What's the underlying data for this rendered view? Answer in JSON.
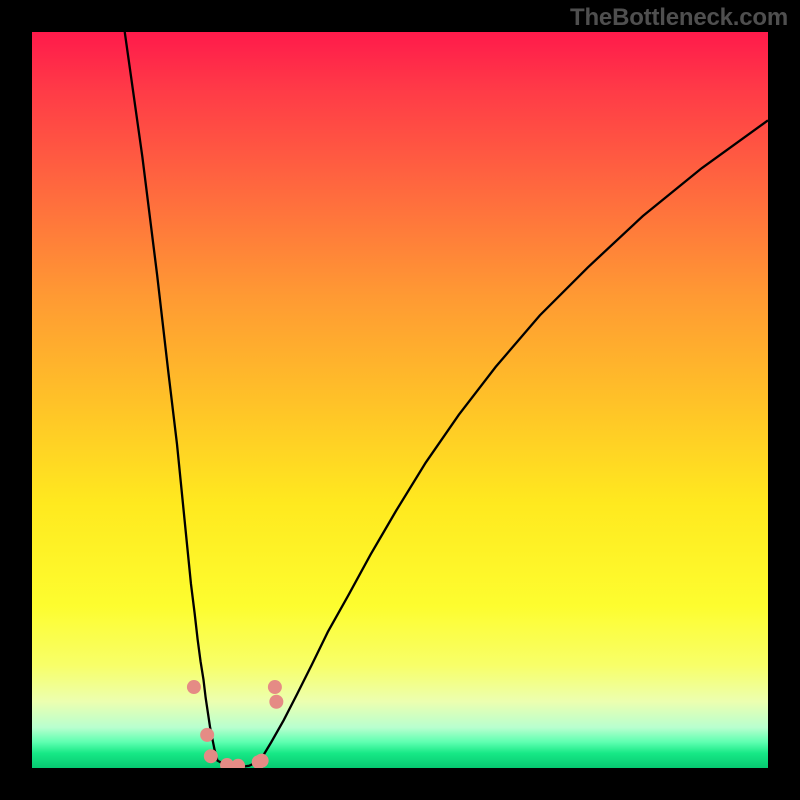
{
  "branding": {
    "text": "TheBottleneck.com"
  },
  "colors": {
    "frame": "#000000",
    "curve_stroke": "#000000",
    "marker_fill": "#e58b85",
    "gradient_stops": [
      "#ff1a4b",
      "#ff3b47",
      "#ff6b3e",
      "#ff9a33",
      "#ffc128",
      "#ffe91f",
      "#fdfd2f",
      "#f8ff68",
      "#ecffb0",
      "#b8ffcf",
      "#5dffb0",
      "#17e886",
      "#06c971"
    ]
  },
  "chart_data": {
    "type": "line",
    "title": "",
    "xlabel": "",
    "ylabel": "",
    "xlim": [
      0,
      100
    ],
    "ylim": [
      0,
      100
    ],
    "note": "Axes carry no tick labels in source; x/y in 0-100 plot-percent coords from top-left. Bottleneck V-curve: tight notch near x≈25, minimum y≈100 (bottom).",
    "series": [
      {
        "name": "left_branch",
        "x": [
          12.6,
          15.0,
          17.0,
          18.5,
          19.7,
          20.5,
          21.1,
          21.6,
          22.1,
          22.5,
          22.9,
          23.3,
          23.6,
          23.9,
          24.2,
          24.5,
          24.8,
          25.2
        ],
        "y": [
          0.0,
          17.0,
          33.0,
          46.0,
          56.0,
          64.0,
          70.0,
          75.0,
          79.0,
          82.5,
          85.5,
          88.0,
          90.5,
          92.5,
          94.5,
          96.0,
          97.5,
          99.0
        ]
      },
      {
        "name": "valley_floor",
        "x": [
          25.2,
          26.5,
          28.0,
          29.5,
          31.0
        ],
        "y": [
          99.0,
          99.7,
          99.9,
          99.7,
          99.0
        ]
      },
      {
        "name": "right_branch",
        "x": [
          31.0,
          32.5,
          34.2,
          36.0,
          38.0,
          40.2,
          43.0,
          46.0,
          49.5,
          53.5,
          58.0,
          63.0,
          69.0,
          75.5,
          83.0,
          91.0,
          100.0
        ],
        "y": [
          99.0,
          96.5,
          93.5,
          90.0,
          86.0,
          81.5,
          76.5,
          71.0,
          65.0,
          58.5,
          52.0,
          45.5,
          38.5,
          32.0,
          25.0,
          18.5,
          12.0
        ]
      }
    ],
    "markers": {
      "name": "highlighted_points",
      "shape": "dot",
      "radius_px": 7,
      "points": [
        {
          "x": 22.0,
          "y": 89.0
        },
        {
          "x": 23.8,
          "y": 95.5
        },
        {
          "x": 24.3,
          "y": 98.4
        },
        {
          "x": 26.5,
          "y": 99.6
        },
        {
          "x": 28.0,
          "y": 99.7
        },
        {
          "x": 30.8,
          "y": 99.2
        },
        {
          "x": 31.2,
          "y": 99.0
        },
        {
          "x": 33.0,
          "y": 89.0
        },
        {
          "x": 33.2,
          "y": 91.0
        }
      ]
    }
  }
}
